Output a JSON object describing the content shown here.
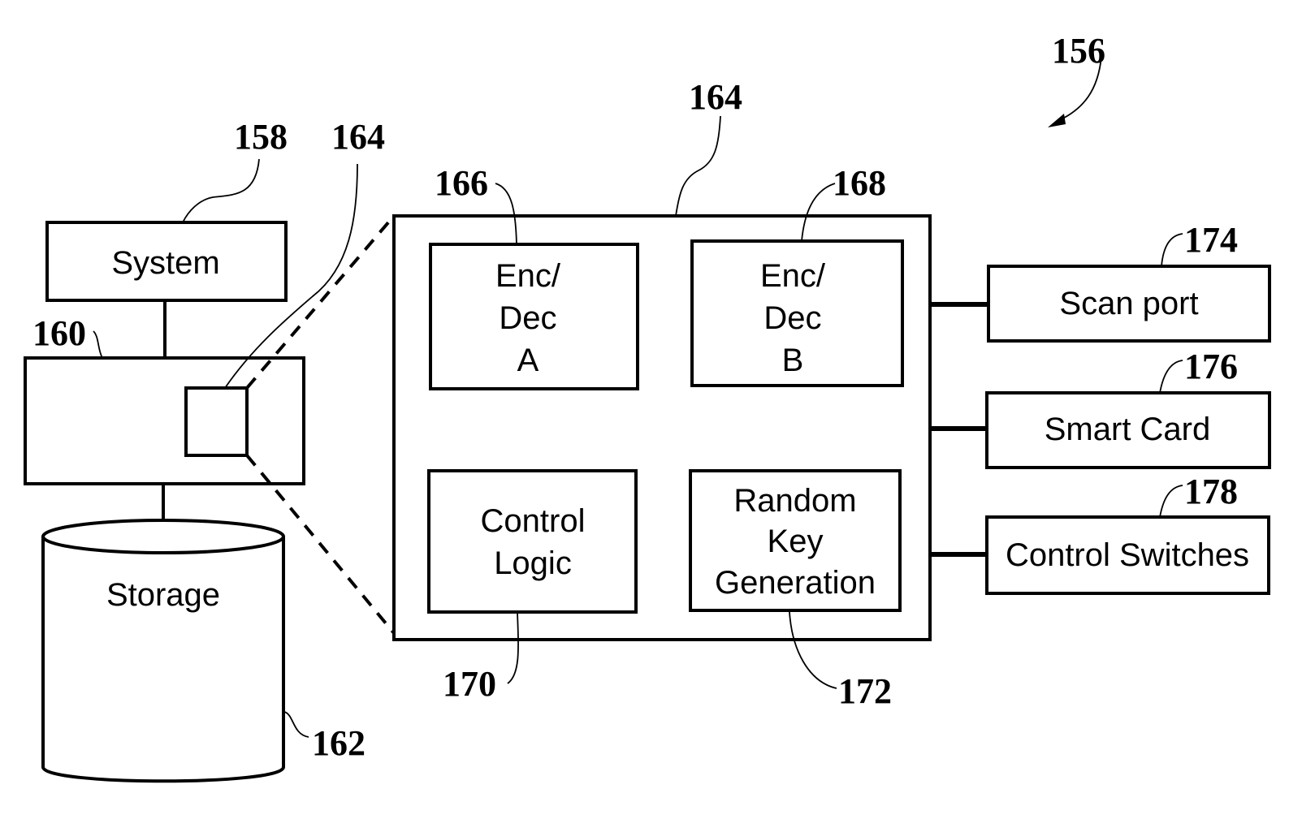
{
  "figure_ref": "156",
  "system": {
    "label": "System",
    "ref": "158"
  },
  "host": {
    "ref": "160"
  },
  "chip_callout": {
    "ref": "164"
  },
  "storage": {
    "label": "Storage",
    "ref": "162"
  },
  "module": {
    "ref": "164",
    "blocks": [
      {
        "lines": [
          "Enc/",
          "Dec",
          "A"
        ],
        "ref": "166"
      },
      {
        "lines": [
          "Enc/",
          "Dec",
          "B"
        ],
        "ref": "168"
      },
      {
        "lines": [
          "Control",
          "Logic"
        ],
        "ref": "170"
      },
      {
        "lines": [
          "Random",
          "Key",
          "Generation"
        ],
        "ref": "172"
      }
    ]
  },
  "peripherals": [
    {
      "label": "Scan port",
      "ref": "174"
    },
    {
      "label": "Smart Card",
      "ref": "176"
    },
    {
      "label": "Control Switches",
      "ref": "178"
    }
  ]
}
